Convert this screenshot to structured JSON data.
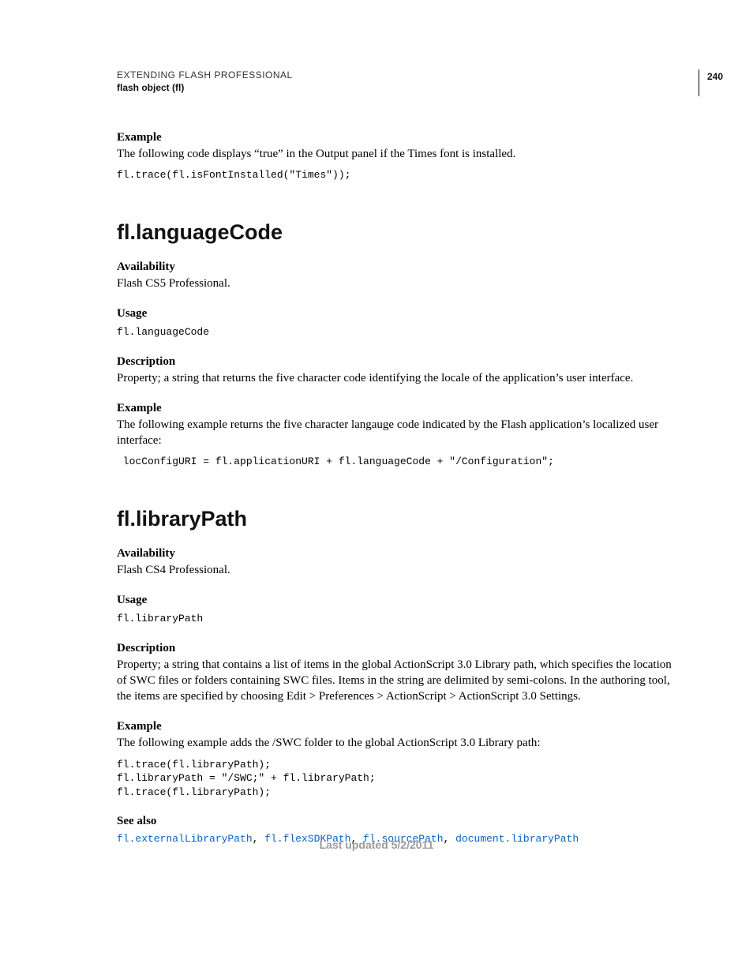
{
  "header": {
    "title": "EXTENDING FLASH PROFESSIONAL",
    "subtitle": "flash object (fl)",
    "page_number": "240"
  },
  "s0": {
    "example_label": "Example",
    "example_text": "The following code displays “true” in the Output panel if the Times font is installed.",
    "code": "fl.trace(fl.isFontInstalled(\"Times\"));"
  },
  "s1": {
    "title": "fl.languageCode",
    "availability_label": "Availability",
    "availability_text": "Flash CS5 Professional.",
    "usage_label": "Usage",
    "usage_code": "fl.languageCode",
    "description_label": "Description",
    "description_text": "Property; a string that returns the five character code identifying the locale of the application’s user interface.",
    "example_label": "Example",
    "example_text": "The following example returns the five character langauge code indicated by the Flash application’s localized user interface:",
    "example_code": " locConfigURI = fl.applicationURI + fl.languageCode + \"/Configuration\";"
  },
  "s2": {
    "title": "fl.libraryPath",
    "availability_label": "Availability",
    "availability_text": "Flash CS4 Professional.",
    "usage_label": "Usage",
    "usage_code": "fl.libraryPath",
    "description_label": "Description",
    "description_text": "Property; a string that contains a list of items in the global ActionScript 3.0 Library path, which specifies the location of SWC files or folders containing SWC files. Items in the string are delimited by semi-colons. In the authoring tool, the items are specified by choosing Edit > Preferences > ActionScript > ActionScript 3.0 Settings.",
    "example_label": "Example",
    "example_text": "The following example adds the /SWC folder to the global ActionScript 3.0 Library path:",
    "example_code": "fl.trace(fl.libraryPath);\nfl.libraryPath = \"/SWC;\" + fl.libraryPath;\nfl.trace(fl.libraryPath);",
    "see_also_label": "See also",
    "see_also": [
      "fl.externalLibraryPath",
      "fl.flexSDKPath",
      "fl.sourcePath",
      "document.libraryPath"
    ],
    "separator": ", "
  },
  "footer": {
    "updated": "Last updated 5/2/2011"
  }
}
